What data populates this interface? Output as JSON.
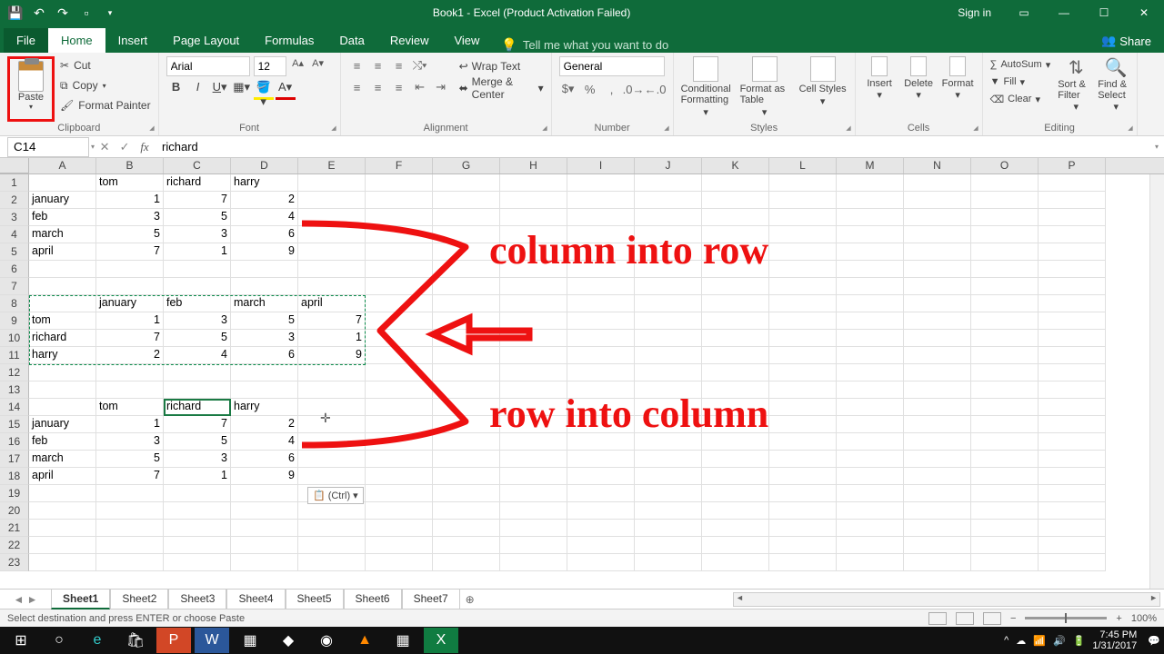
{
  "title": "Book1 - Excel (Product Activation Failed)",
  "signin": "Sign in",
  "tabs": {
    "file": "File",
    "home": "Home",
    "insert": "Insert",
    "pagelayout": "Page Layout",
    "formulas": "Formulas",
    "data": "Data",
    "review": "Review",
    "view": "View"
  },
  "tellme": "Tell me what you want to do",
  "share": "Share",
  "clipboard": {
    "paste": "Paste",
    "cut": "Cut",
    "copy": "Copy",
    "fmt": "Format Painter",
    "label": "Clipboard"
  },
  "font": {
    "name": "Arial",
    "size": "12",
    "label": "Font"
  },
  "alignment": {
    "wrap": "Wrap Text",
    "merge": "Merge & Center",
    "label": "Alignment"
  },
  "number": {
    "fmt": "General",
    "label": "Number"
  },
  "styles": {
    "cond": "Conditional Formatting",
    "table": "Format as Table",
    "cell": "Cell Styles",
    "label": "Styles"
  },
  "cells": {
    "label": "Cells",
    "ins": "Insert",
    "del": "Delete",
    "fmt": "Format"
  },
  "editing": {
    "sum": "AutoSum",
    "fill": "Fill",
    "clear": "Clear",
    "sort": "Sort & Filter",
    "find": "Find & Select",
    "label": "Editing"
  },
  "namebox": "C14",
  "formula_value": "richard",
  "columns": [
    "A",
    "B",
    "C",
    "D",
    "E",
    "F",
    "G",
    "H",
    "I",
    "J",
    "K",
    "L",
    "M",
    "N",
    "O",
    "P"
  ],
  "sheets": [
    "Sheet1",
    "Sheet2",
    "Sheet3",
    "Sheet4",
    "Sheet5",
    "Sheet6",
    "Sheet7"
  ],
  "active_sheet": 0,
  "status": "Select destination and press ENTER or choose Paste",
  "zoom": "100%",
  "time": "7:45 PM",
  "date": "1/31/2017",
  "pasteopt": "(Ctrl)",
  "annot1": "column into row",
  "annot2": "row into column",
  "chart_data": {
    "type": "table",
    "block1": {
      "cols": [
        "tom",
        "richard",
        "harry"
      ],
      "rows": [
        "january",
        "feb",
        "march",
        "april"
      ],
      "values": [
        [
          1,
          7,
          2
        ],
        [
          3,
          5,
          4
        ],
        [
          5,
          3,
          6
        ],
        [
          7,
          1,
          9
        ]
      ],
      "start": "A1"
    },
    "block2_transposed": {
      "cols": [
        "january",
        "feb",
        "march",
        "april"
      ],
      "rows": [
        "tom",
        "richard",
        "harry"
      ],
      "values": [
        [
          1,
          3,
          5,
          7
        ],
        [
          7,
          5,
          3,
          1
        ],
        [
          2,
          4,
          6,
          9
        ]
      ],
      "start": "A8"
    },
    "block3": {
      "cols": [
        "tom",
        "richard",
        "harry"
      ],
      "rows": [
        "january",
        "feb",
        "march",
        "april"
      ],
      "values": [
        [
          1,
          7,
          2
        ],
        [
          3,
          5,
          4
        ],
        [
          5,
          3,
          6
        ],
        [
          7,
          1,
          9
        ]
      ],
      "start": "A14"
    },
    "active_cell": "C14",
    "marquee_range": "A8:E11"
  },
  "g": {
    "b1": {
      "B1": "tom",
      "C1": "richard",
      "D1": "harry",
      "A2": "january",
      "B2": "1",
      "C2": "7",
      "D2": "2",
      "A3": "feb",
      "B3": "3",
      "C3": "5",
      "D3": "4",
      "A4": "march",
      "B4": "5",
      "C4": "3",
      "D4": "6",
      "A5": "april",
      "B5": "7",
      "C5": "1",
      "D5": "9"
    },
    "b2": {
      "B8": "january",
      "C8": "feb",
      "D8": "march",
      "E8": "april",
      "A9": "tom",
      "B9": "1",
      "C9": "3",
      "D9": "5",
      "E9": "7",
      "A10": "richard",
      "B10": "7",
      "C10": "5",
      "D10": "3",
      "E10": "1",
      "A11": "harry",
      "B11": "2",
      "C11": "4",
      "D11": "6",
      "E11": "9"
    },
    "b3": {
      "B14": "tom",
      "C14": "richard",
      "D14": "harry",
      "A15": "january",
      "B15": "1",
      "C15": "7",
      "D15": "2",
      "A16": "feb",
      "B16": "3",
      "C16": "5",
      "D16": "4",
      "A17": "march",
      "B17": "5",
      "C17": "3",
      "D17": "6",
      "A18": "april",
      "B18": "7",
      "C18": "1",
      "D18": "9"
    }
  }
}
